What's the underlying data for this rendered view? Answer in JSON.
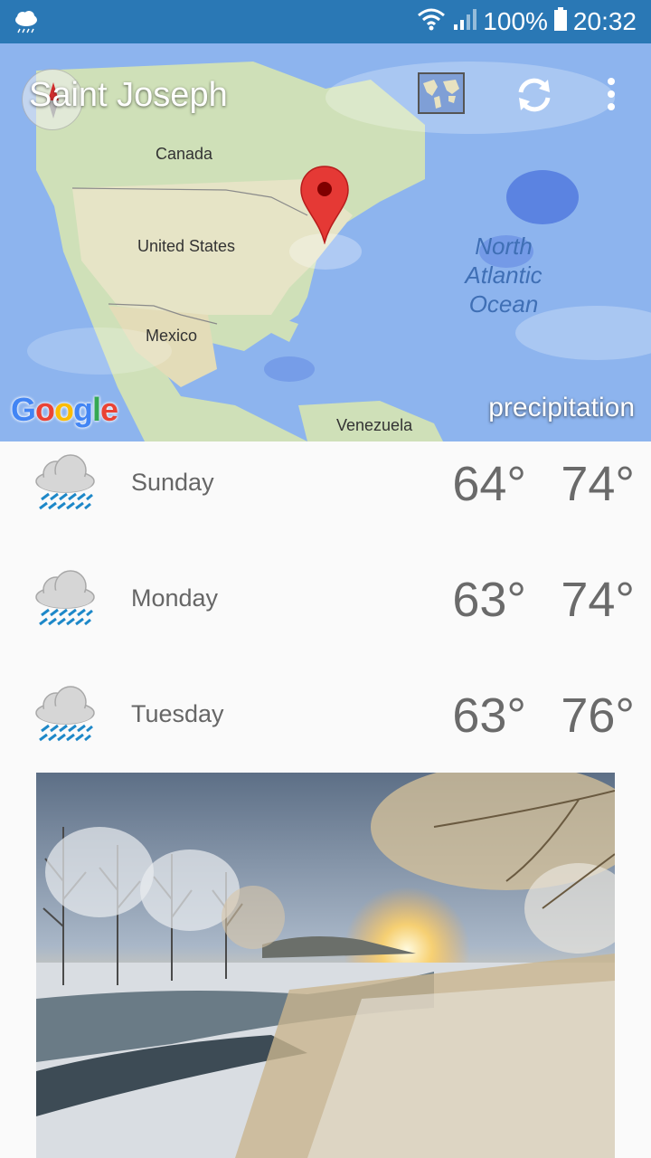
{
  "status_bar": {
    "battery": "100%",
    "time": "20:32",
    "notification_icon": "cloud-rain-icon"
  },
  "header": {
    "city": "Saint Joseph",
    "map_type_icon": "world-map-icon",
    "refresh_icon": "refresh-icon",
    "menu_icon": "more-vertical-icon"
  },
  "map": {
    "labels": {
      "canada": "Canada",
      "united_states": "United States",
      "mexico": "Mexico",
      "venezuela": "Venezuela",
      "ocean_line1": "North",
      "ocean_line2": "Atlantic",
      "ocean_line3": "Ocean"
    },
    "provider": "Google",
    "layer": "precipitation"
  },
  "forecast": [
    {
      "day": "Sunday",
      "low": "64°",
      "high": "74°",
      "icon": "rain-cloud-icon"
    },
    {
      "day": "Monday",
      "low": "63°",
      "high": "74°",
      "icon": "rain-cloud-icon"
    },
    {
      "day": "Tuesday",
      "low": "63°",
      "high": "76°",
      "icon": "rain-cloud-icon"
    }
  ],
  "colors": {
    "status_bar": "#2a78b5",
    "pin": "#e53935",
    "rain": "#1e88c8"
  }
}
